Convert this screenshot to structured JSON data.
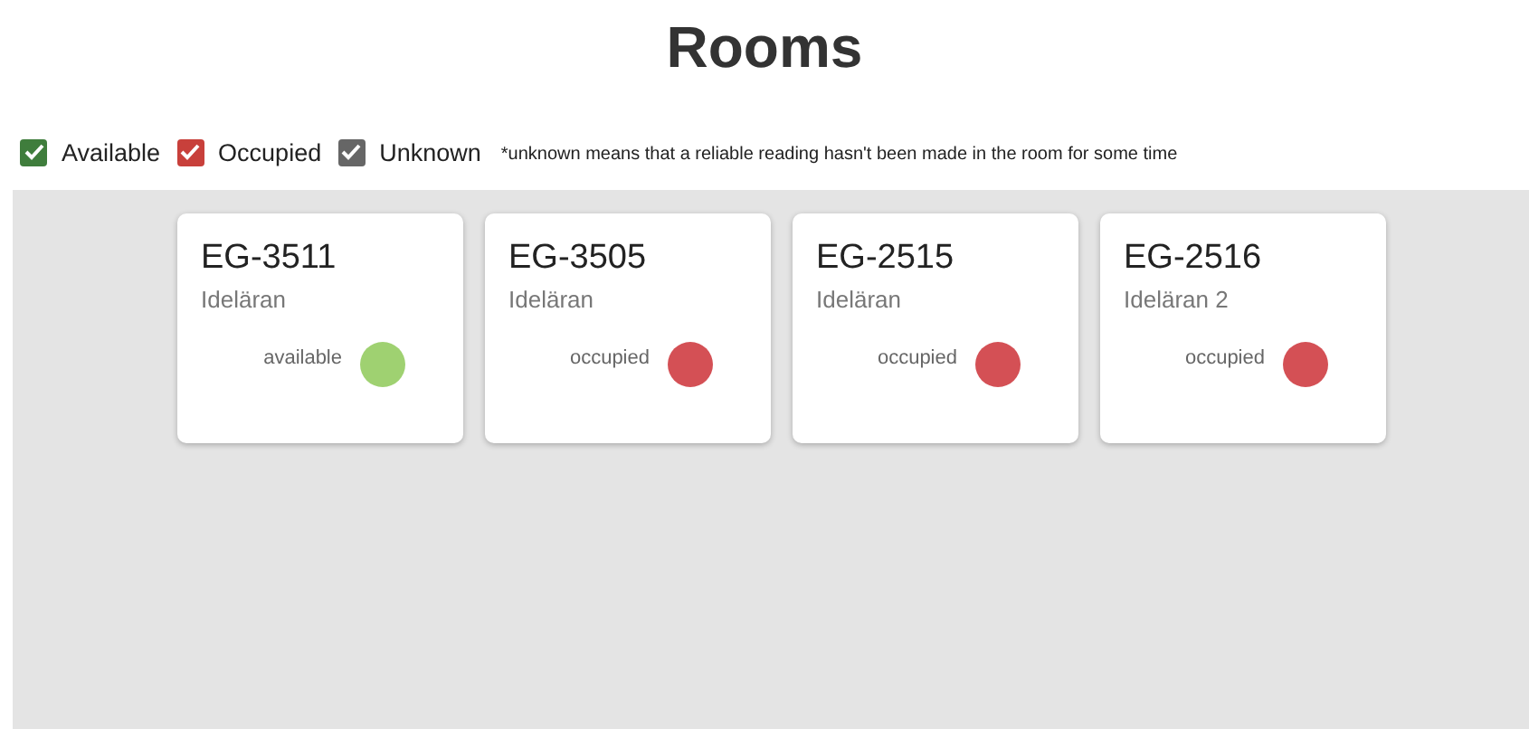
{
  "title": "Rooms",
  "filters": [
    {
      "label": "Available",
      "checked": true,
      "color": "#3f7d3c"
    },
    {
      "label": "Occupied",
      "checked": true,
      "color": "#c8403b"
    },
    {
      "label": "Unknown",
      "checked": true,
      "color": "#666666"
    }
  ],
  "note": "*unknown means that a reliable reading hasn't been made in the room for some time",
  "rooms": [
    {
      "name": "EG-3511",
      "building": "Ideläran",
      "status": "available",
      "color": "#9fd171"
    },
    {
      "name": "EG-3505",
      "building": "Ideläran",
      "status": "occupied",
      "color": "#d45055"
    },
    {
      "name": "EG-2515",
      "building": "Ideläran",
      "status": "occupied",
      "color": "#d45055"
    },
    {
      "name": "EG-2516",
      "building": "Ideläran 2",
      "status": "occupied",
      "color": "#d45055"
    }
  ]
}
